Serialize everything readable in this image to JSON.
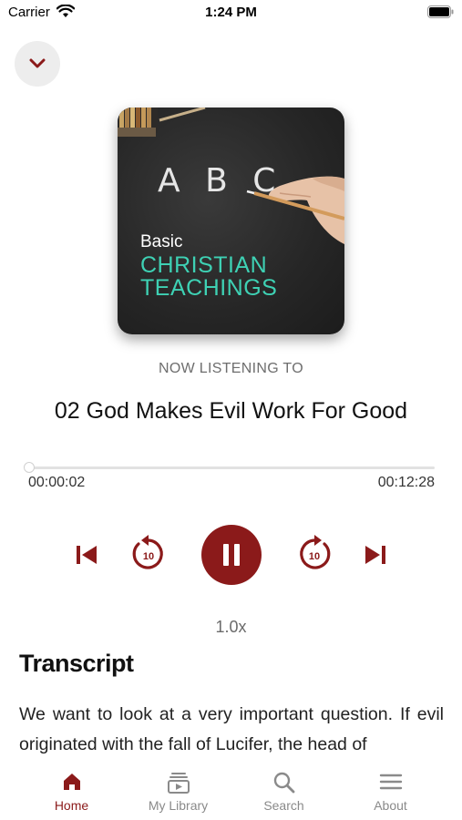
{
  "status_bar": {
    "carrier": "Carrier",
    "time": "1:24 PM"
  },
  "colors": {
    "accent": "#8b1a1a",
    "art_teal": "#3ed1b4",
    "inactive": "#8a8a8a"
  },
  "player": {
    "collapse_icon": "chevron-down-icon",
    "artwork": {
      "letters": "A B C",
      "line1": "Basic",
      "line2": "CHRISTIAN",
      "line3": "TEACHINGS"
    },
    "now_listening_label": "NOW LISTENING TO",
    "track_title": "02 God Makes Evil Work For Good",
    "elapsed": "00:00:02",
    "duration": "00:12:28",
    "progress_fraction": 0.003,
    "controls": {
      "previous_icon": "skip-previous-icon",
      "rewind_icon": "rewind-10-icon",
      "rewind_seconds": "10",
      "pause_icon": "pause-icon",
      "forward_icon": "forward-10-icon",
      "forward_seconds": "10",
      "next_icon": "skip-next-icon"
    },
    "speed": "1.0x"
  },
  "transcript": {
    "heading": "Transcript",
    "text": "We want to look at a very important question. If evil originated with the fall of Lucifer, the head of"
  },
  "tabs": [
    {
      "label": "Home",
      "icon": "home-icon",
      "active": true
    },
    {
      "label": "My Library",
      "icon": "library-icon",
      "active": false
    },
    {
      "label": "Search",
      "icon": "search-icon",
      "active": false
    },
    {
      "label": "About",
      "icon": "menu-icon",
      "active": false
    }
  ]
}
